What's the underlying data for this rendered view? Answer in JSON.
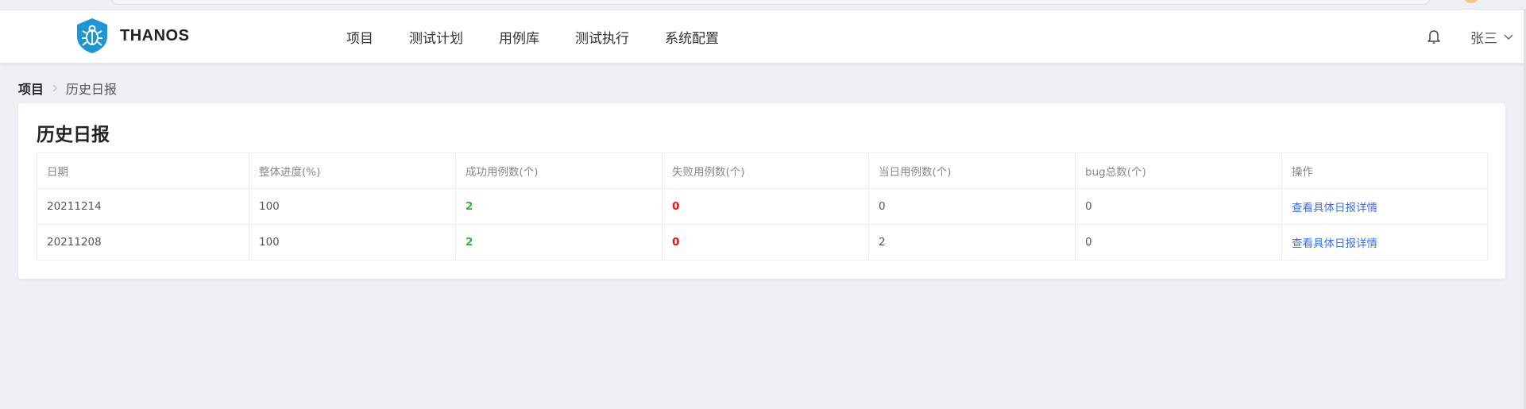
{
  "app": {
    "name": "THANOS"
  },
  "nav": [
    "项目",
    "测试计划",
    "用例库",
    "测试执行",
    "系统配置"
  ],
  "user": {
    "name": "张三"
  },
  "breadcrumb": {
    "root": "项目",
    "current": "历史日报"
  },
  "page": {
    "title": "历史日报"
  },
  "table": {
    "columns": [
      "日期",
      "整体进度(%)",
      "成功用例数(个)",
      "失败用例数(个)",
      "当日用例数(个)",
      "bug总数(个)",
      "操作"
    ],
    "rows": [
      {
        "date": "20211214",
        "progress": "100",
        "success": "2",
        "fail": "0",
        "daily": "0",
        "bugs": "0",
        "action": "查看具体日报详情"
      },
      {
        "date": "20211208",
        "progress": "100",
        "success": "2",
        "fail": "0",
        "daily": "2",
        "bugs": "0",
        "action": "查看具体日报详情"
      }
    ]
  },
  "colors": {
    "success": "#2dbb2d",
    "fail": "#ee1111",
    "link": "#3d6ff0",
    "logo": "#1f95d6"
  }
}
